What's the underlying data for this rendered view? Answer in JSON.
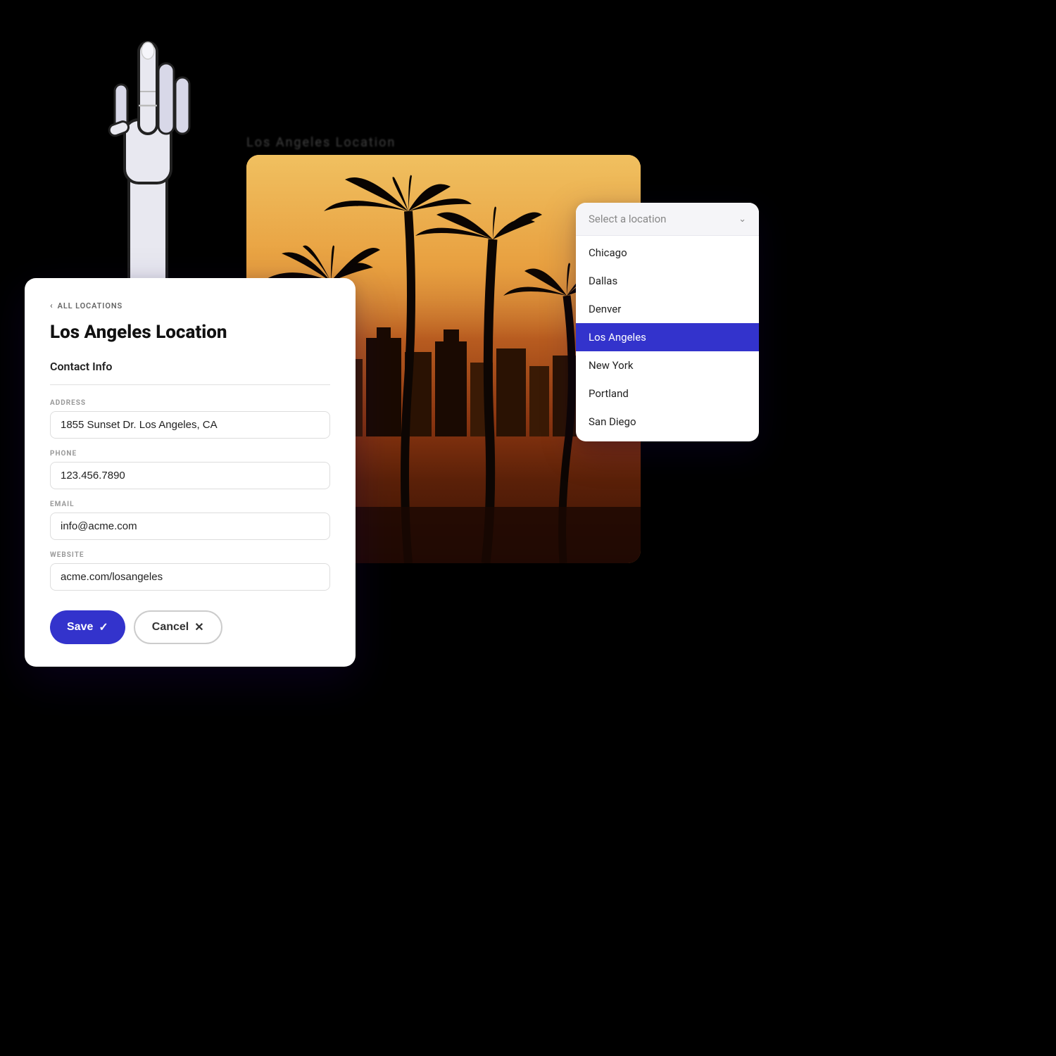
{
  "page": {
    "background": "#000000"
  },
  "back_link": {
    "label": "ALL LOCATIONS"
  },
  "form": {
    "title": "Los Angeles Location",
    "section_label": "Contact Info",
    "fields": {
      "address": {
        "label": "ADDRESS",
        "value": "1855 Sunset Dr. Los Angeles, CA"
      },
      "phone": {
        "label": "PHONE",
        "value": "123.456.7890"
      },
      "email": {
        "label": "EMAIL",
        "value": "info@acme.com"
      },
      "website": {
        "label": "WEBSITE",
        "value": "acme.com/losangeles"
      }
    },
    "save_button": "Save",
    "cancel_button": "Cancel"
  },
  "dropdown": {
    "placeholder": "Select a location",
    "items": [
      {
        "label": "Chicago",
        "active": false
      },
      {
        "label": "Dallas",
        "active": false
      },
      {
        "label": "Denver",
        "active": false
      },
      {
        "label": "Los Angeles",
        "active": true
      },
      {
        "label": "New York",
        "active": false
      },
      {
        "label": "Portland",
        "active": false
      },
      {
        "label": "San Diego",
        "active": false
      }
    ]
  },
  "bg_text": "Los Angeles Location"
}
